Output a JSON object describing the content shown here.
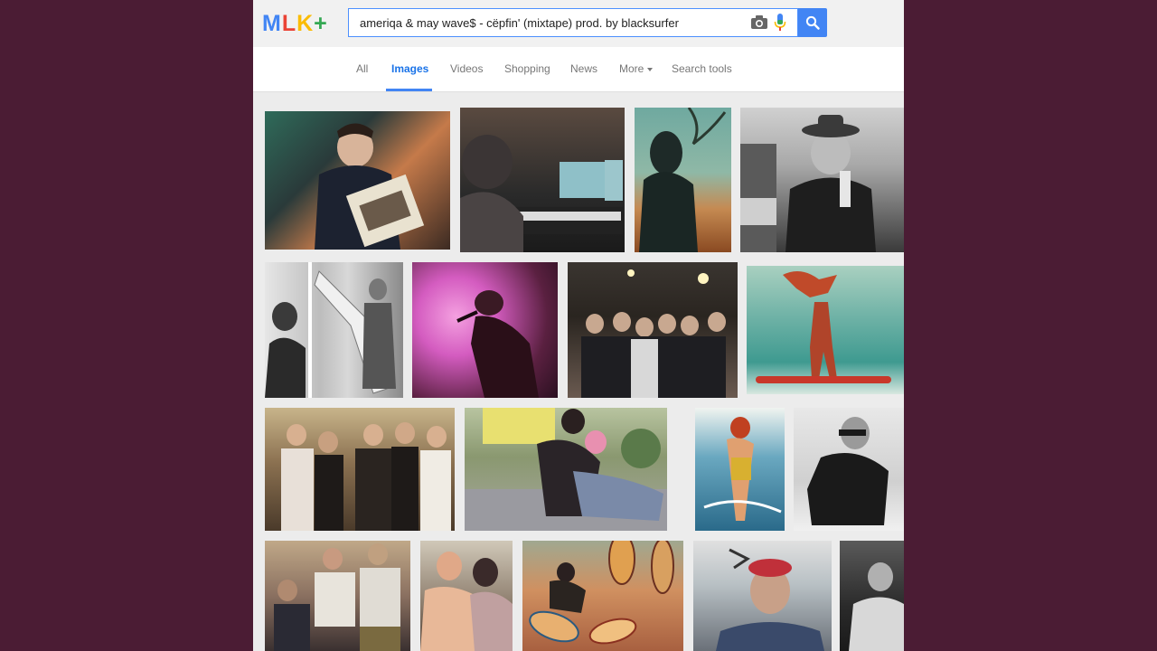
{
  "logo": {
    "letters": [
      "M",
      "L",
      "K",
      "+"
    ],
    "colors": [
      "#4285f4",
      "#ea4335",
      "#fbbc05",
      "#34a853"
    ]
  },
  "search": {
    "query": "ameriqa & may wave$ - cëpfin' (mixtape) prod. by blacksurfer"
  },
  "tabs": [
    {
      "label": "All"
    },
    {
      "label": "Images"
    },
    {
      "label": "Videos"
    },
    {
      "label": "Shopping"
    },
    {
      "label": "News"
    },
    {
      "label": "More"
    },
    {
      "label": "Search tools"
    }
  ],
  "active_tab": "Images",
  "colors": {
    "accent": "#4285f4",
    "background": "#4b1c34"
  }
}
